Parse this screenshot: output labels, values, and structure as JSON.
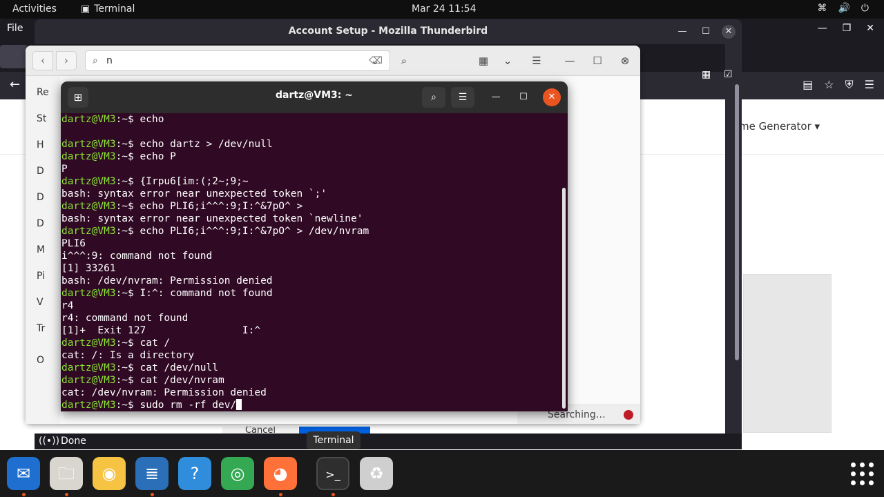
{
  "topbar": {
    "activities": "Activities",
    "app_name": "Terminal",
    "clock": "Mar 24  11:54"
  },
  "firefox": {
    "menu_file": "File",
    "page_generator": "me Generator ▾"
  },
  "thunderbird": {
    "title": "Account Setup - Mozilla Thunderbird",
    "status_done": "Done",
    "cancel_label": "Cancel"
  },
  "files": {
    "search_value": "n",
    "searching": "Searching…",
    "sidebar_letters": [
      "Re",
      "St",
      "H",
      "D",
      "D",
      "D",
      "M",
      "Pi",
      "V",
      "Tr",
      "O"
    ]
  },
  "terminal": {
    "title": "dartz@VM3: ~",
    "prompt": "dartz@VM3:~$",
    "lines": [
      {
        "type": "cmd",
        "text": " echo"
      },
      {
        "type": "out",
        "text": ""
      },
      {
        "type": "cmd",
        "text": " echo dartz > /dev/null"
      },
      {
        "type": "cmd",
        "text": " echo P"
      },
      {
        "type": "out",
        "text": "P"
      },
      {
        "type": "cmd",
        "text": " {Irpu6[im:(;2~;9;~"
      },
      {
        "type": "out",
        "text": "bash: syntax error near unexpected token `;'"
      },
      {
        "type": "cmd",
        "text": " echo PLI6;i^^^:9;I:^&7pO^ >"
      },
      {
        "type": "out",
        "text": "bash: syntax error near unexpected token `newline'"
      },
      {
        "type": "cmd",
        "text": " echo PLI6;i^^^:9;I:^&7pO^ > /dev/nvram"
      },
      {
        "type": "out",
        "text": "PLI6"
      },
      {
        "type": "out",
        "text": "i^^^:9: command not found"
      },
      {
        "type": "out",
        "text": "[1] 33261"
      },
      {
        "type": "out",
        "text": "bash: /dev/nvram: Permission denied"
      },
      {
        "type": "cmd",
        "text": " I:^: command not found"
      },
      {
        "type": "out",
        "text": "r4"
      },
      {
        "type": "out",
        "text": "r4: command not found"
      },
      {
        "type": "out",
        "text": "[1]+  Exit 127                I:^"
      },
      {
        "type": "cmd",
        "text": " cat /"
      },
      {
        "type": "out",
        "text": "cat: /: Is a directory"
      },
      {
        "type": "cmd",
        "text": " cat /dev/null"
      },
      {
        "type": "cmd",
        "text": " cat /dev/nvram"
      },
      {
        "type": "out",
        "text": "cat: /dev/nvram: Permission denied"
      },
      {
        "type": "cmd",
        "text": " sudo rm -rf dev/",
        "cursor": true
      }
    ]
  },
  "dock": {
    "tooltip": "Terminal",
    "items": [
      {
        "name": "thunderbird-icon",
        "glyph": "✉",
        "color": "#1f6fd0",
        "dot": true
      },
      {
        "name": "files-icon",
        "glyph": "🗀",
        "color": "#d9d6cf",
        "dot": true
      },
      {
        "name": "rhythmbox-icon",
        "glyph": "◉",
        "color": "#f6c342",
        "dot": false
      },
      {
        "name": "writer-icon",
        "glyph": "≣",
        "color": "#2a6fb8",
        "dot": true
      },
      {
        "name": "help-icon",
        "glyph": "?",
        "color": "#2f8ddb",
        "dot": false
      },
      {
        "name": "chrome-icon",
        "glyph": "◎",
        "color": "#34a853",
        "dot": false
      },
      {
        "name": "firefox-icon",
        "glyph": "◕",
        "color": "#ff7139",
        "dot": true
      },
      {
        "name": "terminal-icon",
        "glyph": ">_",
        "color": "#3c3c3c",
        "dot": true
      },
      {
        "name": "trash-icon",
        "glyph": "♻",
        "color": "#cfcfcf",
        "dot": false
      }
    ]
  }
}
